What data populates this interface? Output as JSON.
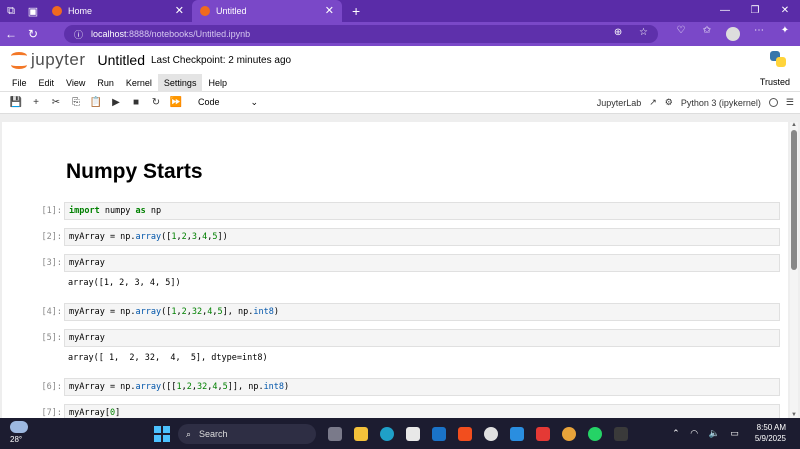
{
  "browser": {
    "tabs": [
      {
        "label": "Home"
      },
      {
        "label": "Untitled"
      }
    ],
    "url_host": "localhost",
    "url_path": ":8888/notebooks/Untitled.ipynb"
  },
  "jupyter": {
    "logo_text": "jupyter",
    "notebook_title": "Untitled",
    "checkpoint": "Last Checkpoint: 2 minutes ago",
    "menu": [
      "File",
      "Edit",
      "View",
      "Run",
      "Kernel",
      "Settings",
      "Help"
    ],
    "trusted": "Trusted",
    "cell_type": "Code",
    "jupyterlab_label": "JupyterLab",
    "kernel": "Python 3 (ipykernel)"
  },
  "notebook": {
    "heading": "Numpy Starts",
    "cells": [
      {
        "prompt": "[1]:",
        "code": "import numpy as np"
      },
      {
        "prompt": "[2]:",
        "code": "myArray = np.array([1,2,3,4,5])"
      },
      {
        "prompt": "[3]:",
        "code": "myArray",
        "output": "array([1, 2, 3, 4, 5])"
      },
      {
        "prompt": "[4]:",
        "code": "myArray = np.array([1,2,32,4,5], np.int8)"
      },
      {
        "prompt": "[5]:",
        "code": "myArray",
        "output": "array([ 1,  2, 32,  4,  5], dtype=int8)"
      },
      {
        "prompt": "[6]:",
        "code": "myArray = np.array([[1,2,32,4,5]], np.int8)"
      },
      {
        "prompt": "[7]:",
        "code": "myArray[0]"
      }
    ]
  },
  "taskbar": {
    "temperature": "28°",
    "search_placeholder": "Search",
    "time": "8:50 AM",
    "date": "5/9/2025"
  }
}
